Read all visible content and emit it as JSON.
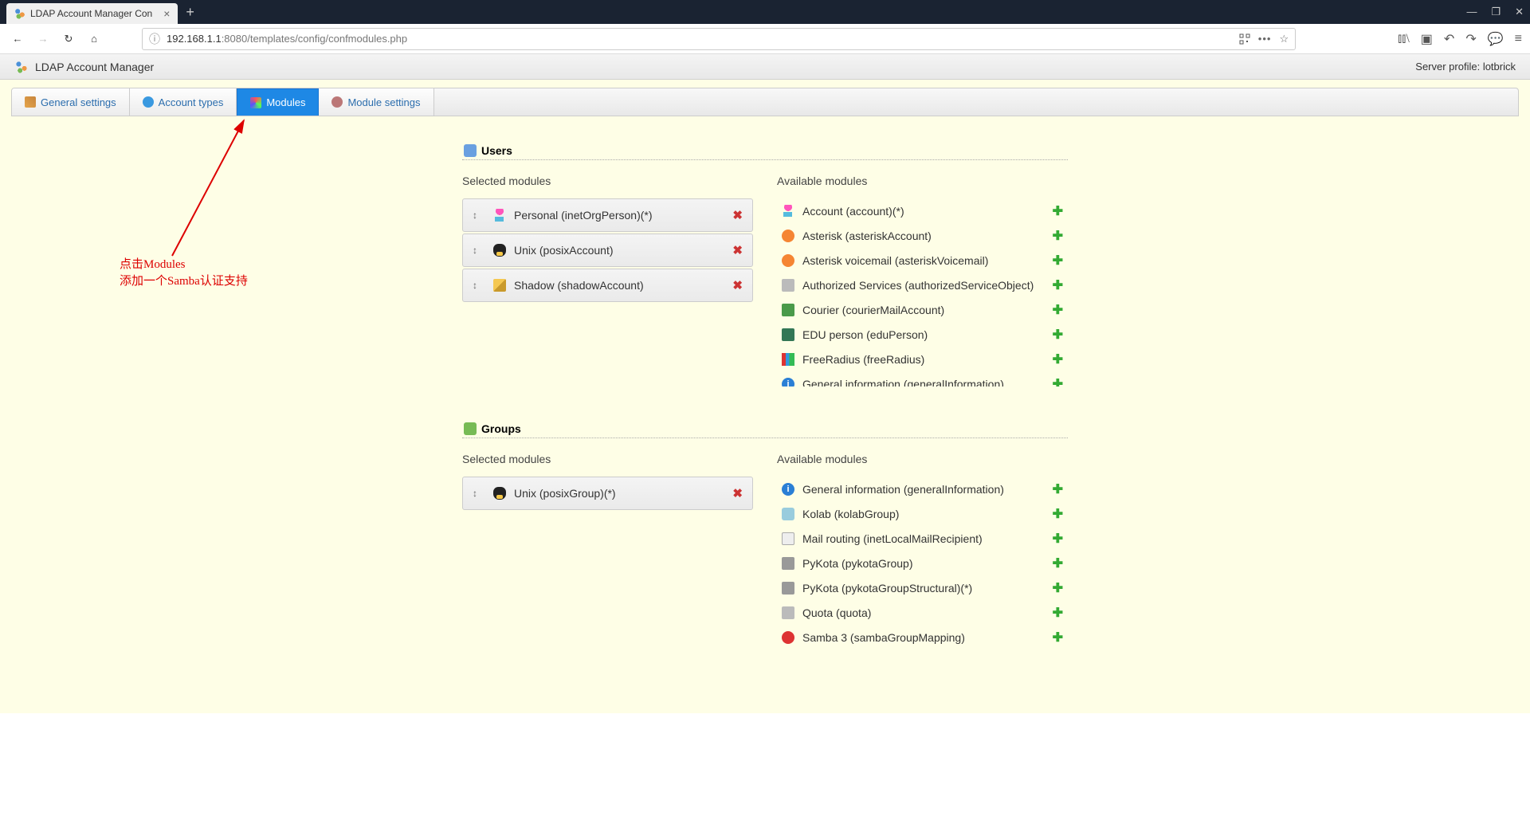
{
  "browser": {
    "tab_title": "LDAP Account Manager Con",
    "url_host": "192.168.1.1",
    "url_path": ":8080/templates/config/confmodules.php"
  },
  "header": {
    "app_title": "LDAP Account Manager",
    "server_profile_label": "Server profile: lotbrick"
  },
  "tabs": {
    "general": "General settings",
    "account_types": "Account types",
    "modules": "Modules",
    "module_settings": "Module settings"
  },
  "annotation": {
    "line1": "点击Modules",
    "line2": "添加一个Samba认证支持"
  },
  "users_section": {
    "title": "Users",
    "selected_heading": "Selected modules",
    "available_heading": "Available modules",
    "selected": [
      {
        "icon": "i-person",
        "label": "Personal (inetOrgPerson)(*)"
      },
      {
        "icon": "i-tux",
        "label": "Unix (posixAccount)"
      },
      {
        "icon": "i-shadow",
        "label": "Shadow (shadowAccount)"
      }
    ],
    "available": [
      {
        "icon": "i-person",
        "label": "Account (account)(*)"
      },
      {
        "icon": "i-asterisk",
        "label": "Asterisk (asteriskAccount)"
      },
      {
        "icon": "i-asterisk",
        "label": "Asterisk voicemail (asteriskVoicemail)"
      },
      {
        "icon": "i-key",
        "label": "Authorized Services (authorizedServiceObject)"
      },
      {
        "icon": "i-courier",
        "label": "Courier (courierMailAccount)"
      },
      {
        "icon": "i-edu",
        "label": "EDU person (eduPerson)"
      },
      {
        "icon": "i-radio",
        "label": "FreeRadius (freeRadius)"
      },
      {
        "icon": "i-info",
        "label": "General information (generalInformation)"
      }
    ]
  },
  "groups_section": {
    "title": "Groups",
    "selected_heading": "Selected modules",
    "available_heading": "Available modules",
    "selected": [
      {
        "icon": "i-tux",
        "label": "Unix (posixGroup)(*)"
      }
    ],
    "available": [
      {
        "icon": "i-info",
        "label": "General information (generalInformation)"
      },
      {
        "icon": "i-kolab",
        "label": "Kolab (kolabGroup)"
      },
      {
        "icon": "i-mail",
        "label": "Mail routing (inetLocalMailRecipient)"
      },
      {
        "icon": "i-printer",
        "label": "PyKota (pykotaGroup)"
      },
      {
        "icon": "i-printer",
        "label": "PyKota (pykotaGroupStructural)(*)"
      },
      {
        "icon": "i-quota",
        "label": "Quota (quota)"
      },
      {
        "icon": "i-samba",
        "label": "Samba 3 (sambaGroupMapping)"
      }
    ]
  }
}
